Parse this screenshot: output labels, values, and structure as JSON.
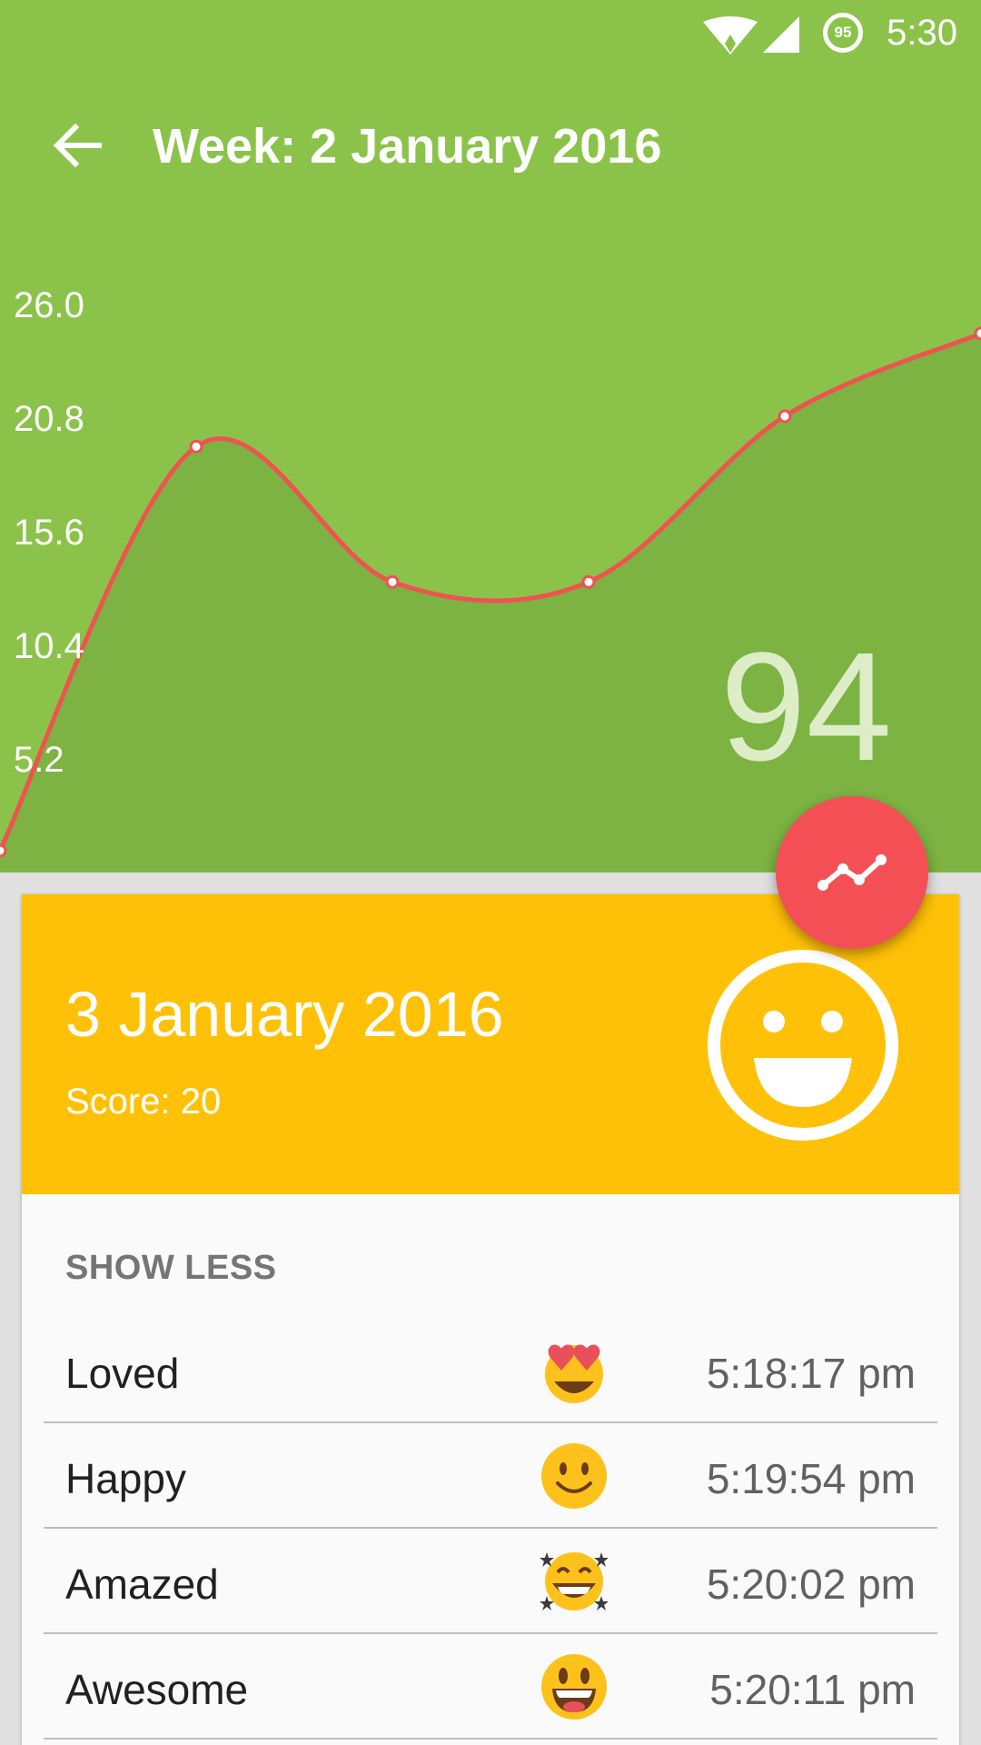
{
  "status_bar": {
    "time": "5:30",
    "battery_level": "95"
  },
  "toolbar": {
    "back_icon": "arrow-back-icon",
    "title": "Week: 2 January 2016"
  },
  "chart_data": {
    "type": "area",
    "x": [
      1,
      2,
      3,
      4,
      5,
      6
    ],
    "values": [
      0,
      20.0,
      13.3,
      13.3,
      21.5,
      25.6
    ],
    "y_ticks": [
      "26.0",
      "20.8",
      "15.6",
      "10.4",
      "5.2"
    ],
    "ylim": [
      0,
      26
    ],
    "line_color": "#ef5350",
    "fill_color": "#7cb342",
    "grid": false
  },
  "weekly_score": "94",
  "fab": {
    "icon": "trending-chart-icon",
    "color": "#f44f55"
  },
  "day_card": {
    "date": "3 January 2016",
    "score_label": "Score: 20",
    "mood_icon": "smiley-face-icon",
    "header_color": "#ffc107",
    "toggle_label": "SHOW LESS",
    "entries": [
      {
        "mood": "Loved",
        "emoji": "heart-eyes-emoji-icon",
        "time": "5:18:17 pm"
      },
      {
        "mood": "Happy",
        "emoji": "slight-smile-emoji-icon",
        "time": "5:19:54 pm"
      },
      {
        "mood": "Amazed",
        "emoji": "star-struck-emoji-icon",
        "time": "5:20:02 pm"
      },
      {
        "mood": "Awesome",
        "emoji": "grinning-tongue-emoji-icon",
        "time": "5:20:11 pm"
      }
    ]
  }
}
